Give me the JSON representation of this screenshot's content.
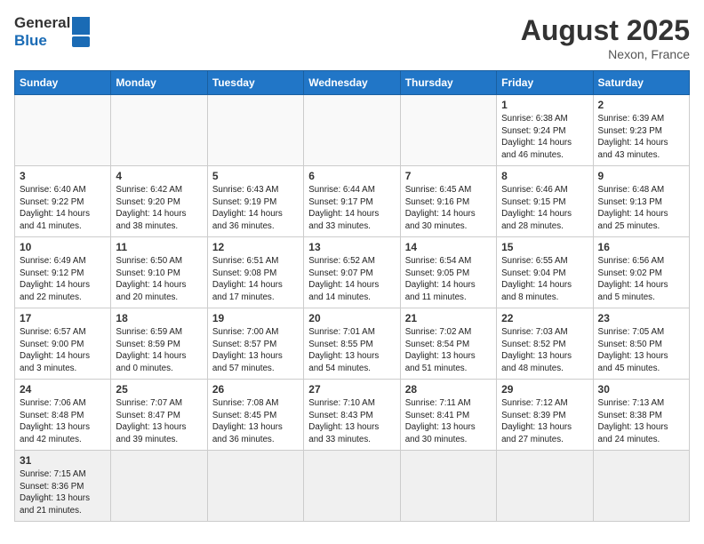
{
  "header": {
    "logo_general": "General",
    "logo_blue": "Blue",
    "month": "August 2025",
    "location": "Nexon, France"
  },
  "weekdays": [
    "Sunday",
    "Monday",
    "Tuesday",
    "Wednesday",
    "Thursday",
    "Friday",
    "Saturday"
  ],
  "weeks": [
    [
      {
        "day": "",
        "info": ""
      },
      {
        "day": "",
        "info": ""
      },
      {
        "day": "",
        "info": ""
      },
      {
        "day": "",
        "info": ""
      },
      {
        "day": "",
        "info": ""
      },
      {
        "day": "1",
        "info": "Sunrise: 6:38 AM\nSunset: 9:24 PM\nDaylight: 14 hours and 46 minutes."
      },
      {
        "day": "2",
        "info": "Sunrise: 6:39 AM\nSunset: 9:23 PM\nDaylight: 14 hours and 43 minutes."
      }
    ],
    [
      {
        "day": "3",
        "info": "Sunrise: 6:40 AM\nSunset: 9:22 PM\nDaylight: 14 hours and 41 minutes."
      },
      {
        "day": "4",
        "info": "Sunrise: 6:42 AM\nSunset: 9:20 PM\nDaylight: 14 hours and 38 minutes."
      },
      {
        "day": "5",
        "info": "Sunrise: 6:43 AM\nSunset: 9:19 PM\nDaylight: 14 hours and 36 minutes."
      },
      {
        "day": "6",
        "info": "Sunrise: 6:44 AM\nSunset: 9:17 PM\nDaylight: 14 hours and 33 minutes."
      },
      {
        "day": "7",
        "info": "Sunrise: 6:45 AM\nSunset: 9:16 PM\nDaylight: 14 hours and 30 minutes."
      },
      {
        "day": "8",
        "info": "Sunrise: 6:46 AM\nSunset: 9:15 PM\nDaylight: 14 hours and 28 minutes."
      },
      {
        "day": "9",
        "info": "Sunrise: 6:48 AM\nSunset: 9:13 PM\nDaylight: 14 hours and 25 minutes."
      }
    ],
    [
      {
        "day": "10",
        "info": "Sunrise: 6:49 AM\nSunset: 9:12 PM\nDaylight: 14 hours and 22 minutes."
      },
      {
        "day": "11",
        "info": "Sunrise: 6:50 AM\nSunset: 9:10 PM\nDaylight: 14 hours and 20 minutes."
      },
      {
        "day": "12",
        "info": "Sunrise: 6:51 AM\nSunset: 9:08 PM\nDaylight: 14 hours and 17 minutes."
      },
      {
        "day": "13",
        "info": "Sunrise: 6:52 AM\nSunset: 9:07 PM\nDaylight: 14 hours and 14 minutes."
      },
      {
        "day": "14",
        "info": "Sunrise: 6:54 AM\nSunset: 9:05 PM\nDaylight: 14 hours and 11 minutes."
      },
      {
        "day": "15",
        "info": "Sunrise: 6:55 AM\nSunset: 9:04 PM\nDaylight: 14 hours and 8 minutes."
      },
      {
        "day": "16",
        "info": "Sunrise: 6:56 AM\nSunset: 9:02 PM\nDaylight: 14 hours and 5 minutes."
      }
    ],
    [
      {
        "day": "17",
        "info": "Sunrise: 6:57 AM\nSunset: 9:00 PM\nDaylight: 14 hours and 3 minutes."
      },
      {
        "day": "18",
        "info": "Sunrise: 6:59 AM\nSunset: 8:59 PM\nDaylight: 14 hours and 0 minutes."
      },
      {
        "day": "19",
        "info": "Sunrise: 7:00 AM\nSunset: 8:57 PM\nDaylight: 13 hours and 57 minutes."
      },
      {
        "day": "20",
        "info": "Sunrise: 7:01 AM\nSunset: 8:55 PM\nDaylight: 13 hours and 54 minutes."
      },
      {
        "day": "21",
        "info": "Sunrise: 7:02 AM\nSunset: 8:54 PM\nDaylight: 13 hours and 51 minutes."
      },
      {
        "day": "22",
        "info": "Sunrise: 7:03 AM\nSunset: 8:52 PM\nDaylight: 13 hours and 48 minutes."
      },
      {
        "day": "23",
        "info": "Sunrise: 7:05 AM\nSunset: 8:50 PM\nDaylight: 13 hours and 45 minutes."
      }
    ],
    [
      {
        "day": "24",
        "info": "Sunrise: 7:06 AM\nSunset: 8:48 PM\nDaylight: 13 hours and 42 minutes."
      },
      {
        "day": "25",
        "info": "Sunrise: 7:07 AM\nSunset: 8:47 PM\nDaylight: 13 hours and 39 minutes."
      },
      {
        "day": "26",
        "info": "Sunrise: 7:08 AM\nSunset: 8:45 PM\nDaylight: 13 hours and 36 minutes."
      },
      {
        "day": "27",
        "info": "Sunrise: 7:10 AM\nSunset: 8:43 PM\nDaylight: 13 hours and 33 minutes."
      },
      {
        "day": "28",
        "info": "Sunrise: 7:11 AM\nSunset: 8:41 PM\nDaylight: 13 hours and 30 minutes."
      },
      {
        "day": "29",
        "info": "Sunrise: 7:12 AM\nSunset: 8:39 PM\nDaylight: 13 hours and 27 minutes."
      },
      {
        "day": "30",
        "info": "Sunrise: 7:13 AM\nSunset: 8:38 PM\nDaylight: 13 hours and 24 minutes."
      }
    ],
    [
      {
        "day": "31",
        "info": "Sunrise: 7:15 AM\nSunset: 8:36 PM\nDaylight: 13 hours and 21 minutes."
      },
      {
        "day": "",
        "info": ""
      },
      {
        "day": "",
        "info": ""
      },
      {
        "day": "",
        "info": ""
      },
      {
        "day": "",
        "info": ""
      },
      {
        "day": "",
        "info": ""
      },
      {
        "day": "",
        "info": ""
      }
    ]
  ]
}
